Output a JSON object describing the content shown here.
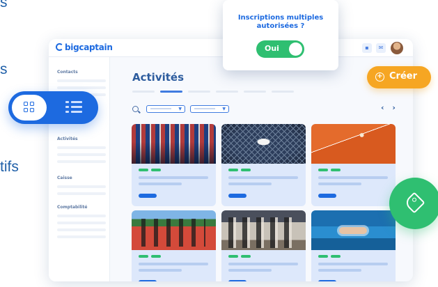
{
  "background_text": {
    "line1": "s",
    "line2": "s",
    "line3": "tifs"
  },
  "app": {
    "logo_text": "bigcaptain",
    "page_title": "Activités",
    "pager": "‹ ›",
    "sidebar": {
      "items": [
        "Contacts",
        "Activités",
        "Caisse",
        "Comptabilité"
      ]
    }
  },
  "popup": {
    "title": "Inscriptions multiples autorisées ?",
    "toggle_label": "Oui",
    "toggle_on": true
  },
  "create_button": {
    "label": "Créer",
    "icon": "plus-circle-icon"
  },
  "view_switch": {
    "active": "grid",
    "grid_icon": "grid-icon",
    "list_icon": "list-icon"
  },
  "tag_button": {
    "icon": "tag-icon"
  },
  "colors": {
    "primary": "#1d6ae0",
    "accent_green": "#2fbf71",
    "accent_orange": "#f6a623",
    "text_blue": "#2d5c9e"
  }
}
